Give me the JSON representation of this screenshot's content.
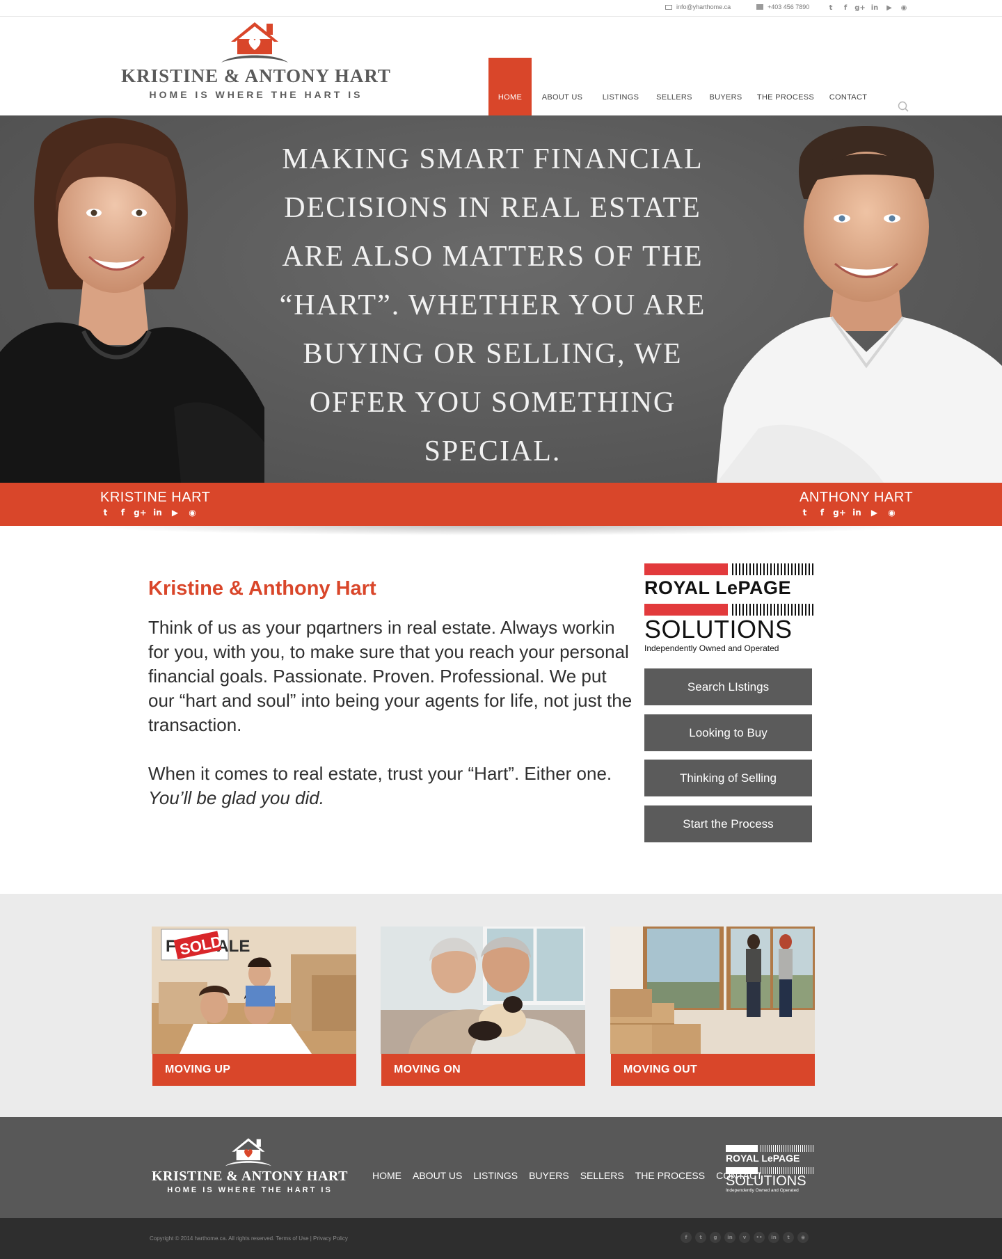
{
  "topbar": {
    "email": "info@yharthome.ca",
    "phone": "+403 456 7890",
    "social_icons": [
      "twitter-icon",
      "facebook-icon",
      "google-plus-icon",
      "linkedin-icon",
      "youtube-icon",
      "rss-icon"
    ]
  },
  "logo": {
    "name": "KRISTINE & ANTONY HART",
    "tagline": "HOME IS WHERE THE HART IS"
  },
  "nav": {
    "items": [
      "HOME",
      "ABOUT US",
      "LISTINGS",
      "SELLERS",
      "BUYERS",
      "THE PROCESS",
      "CONTACT"
    ],
    "active": "HOME"
  },
  "hero": {
    "quote": "Making smart financial decisions in real estate are also matters of the “Hart”. Whether you are buying or selling, we offer you something special."
  },
  "agents": {
    "left": "KRISTINE HART",
    "right": "ANTHONY HART"
  },
  "intro": {
    "title": "Kristine & Anthony Hart",
    "paragraph1": "Think of us as your pqartners in real estate. Always workin for you, with you, to make sure that you reach your personal financial goals. Passionate. Proven. Professional. We put our “hart and soul” into being your agents for life, not just the transaction.",
    "paragraph2": "When it comes to real estate, trust your “Hart”. Either one.",
    "paragraph2_italic": "You’ll be glad you did."
  },
  "brand": {
    "line1": "ROYAL LePAGE",
    "line2": "SOLUTIONS",
    "line3": "Independently Owned and Operated"
  },
  "side_buttons": [
    "Search LIstings",
    "Looking to Buy",
    "Thinking of Selling",
    "Start the Process"
  ],
  "cards": [
    {
      "label": "MOVING UP",
      "sign_text": "SOLD",
      "sign_text2": "FOR SALE"
    },
    {
      "label": "MOVING ON"
    },
    {
      "label": "MOVING OUT"
    }
  ],
  "footer": {
    "nav": [
      "HOME",
      "ABOUT US",
      "LISTINGS",
      "BUYERS",
      "SELLERS",
      "THE PROCESS",
      "CONTACT"
    ],
    "copyright": "Copyright © 2014 harthome.ca. All rights reserved.  Terms of Use | Privacy Policy",
    "social_icons": [
      "facebook-icon",
      "twitter-icon",
      "google-plus-icon",
      "linkedin-icon",
      "vimeo-icon",
      "flickr-icon",
      "linkedin-icon",
      "twitter-icon",
      "rss-icon"
    ]
  },
  "colors": {
    "accent": "#d9462a",
    "dark_gray": "#5b5b5b",
    "footer": "#585858",
    "bottom": "#2e2e2e",
    "light_bg": "#ebebeb"
  }
}
